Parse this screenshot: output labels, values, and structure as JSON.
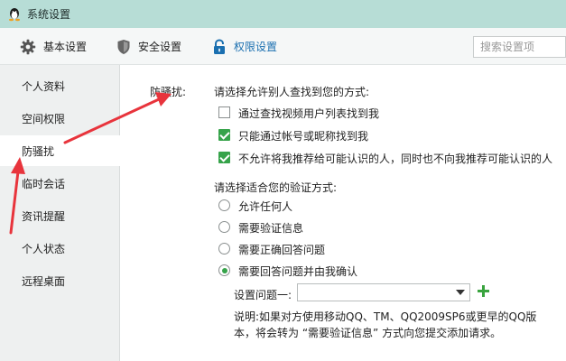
{
  "window": {
    "title": "系统设置"
  },
  "toolbar": {
    "basic": "基本设置",
    "security": "安全设置",
    "permission": "权限设置",
    "search_placeholder": "搜索设置项"
  },
  "sidebar": {
    "items": [
      {
        "label": "个人资料"
      },
      {
        "label": "空间权限"
      },
      {
        "label": "防骚扰"
      },
      {
        "label": "临时会话"
      },
      {
        "label": "资讯提醒"
      },
      {
        "label": "个人状态"
      },
      {
        "label": "远程桌面"
      }
    ]
  },
  "content": {
    "section_label": "防骚扰:",
    "find_prompt": "请选择允许别人查找到您的方式:",
    "find_options": [
      {
        "label": "通过查找视频用户列表找到我",
        "checked": false
      },
      {
        "label": "只能通过帐号或昵称找到我",
        "checked": true
      },
      {
        "label": "不允许将我推荐给可能认识的人，同时也不向我推荐可能认识的人",
        "checked": true
      }
    ],
    "verify_prompt": "请选择适合您的验证方式:",
    "verify_options": [
      {
        "label": "允许任何人",
        "selected": false
      },
      {
        "label": "需要验证信息",
        "selected": false
      },
      {
        "label": "需要正确回答问题",
        "selected": false
      },
      {
        "label": "需要回答问题并由我确认",
        "selected": true
      }
    ],
    "question_label": "设置问题一:",
    "question_value": "",
    "note_line1": "说明:如果对方使用移动QQ、TM、QQ2009SP6或更早的QQ版",
    "note_line2": "本，将会转为 “需要验证信息” 方式向您提交添加请求。"
  },
  "colors": {
    "titlebar": "#b7ddd6",
    "accent": "#1a6fb0",
    "check": "#36a34a",
    "arrow": "#e8343c"
  }
}
